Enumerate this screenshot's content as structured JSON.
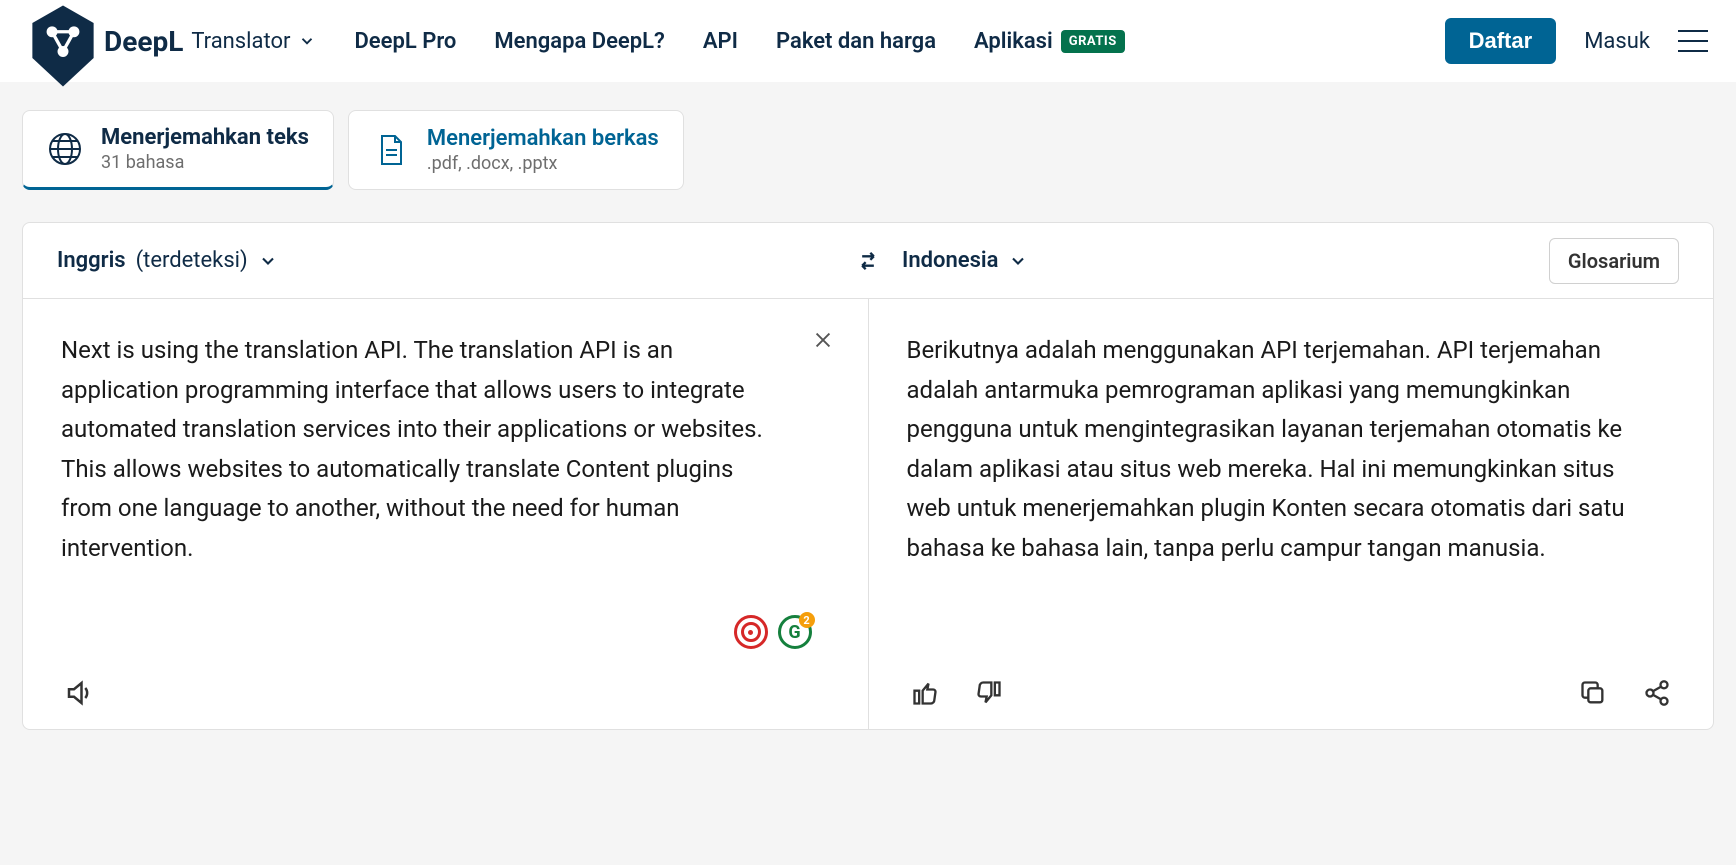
{
  "header": {
    "brand": "DeepL",
    "translator_label": "Translator",
    "nav": {
      "pro": "DeepL Pro",
      "why": "Mengapa DeepL?",
      "api": "API",
      "pricing": "Paket dan harga",
      "apps": "Aplikasi",
      "apps_badge": "GRATIS"
    },
    "signup": "Daftar",
    "login": "Masuk"
  },
  "tabs": {
    "text": {
      "title": "Menerjemahkan teks",
      "sub": "31 bahasa"
    },
    "file": {
      "title": "Menerjemahkan berkas",
      "sub": ".pdf, .docx, .pptx"
    }
  },
  "lang": {
    "source": "Inggris",
    "detected": "(terdeteksi)",
    "target": "Indonesia",
    "glossary": "Glosarium"
  },
  "source_text": "Next is using the translation API. The translation API is an application programming interface that allows users to integrate automated translation services into their applications or websites. This allows websites to automatically translate Content plugins from one language to another, without the need for human intervention.",
  "target_text": "Berikutnya adalah menggunakan API terjemahan. API terjemahan adalah antarmuka pemrograman aplikasi yang memungkinkan pengguna untuk mengintegrasikan layanan terjemahan otomatis ke dalam aplikasi atau situs web mereka. Hal ini memungkinkan situs web untuk menerjemahkan plugin Konten secara otomatis dari satu bahasa ke bahasa lain, tanpa perlu campur tangan manusia."
}
